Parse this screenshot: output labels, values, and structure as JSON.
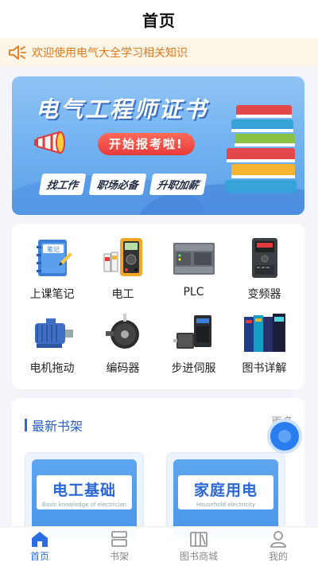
{
  "header": {
    "title": "首页"
  },
  "notice": {
    "text": "欢迎使用电气大全学习相关知识"
  },
  "banner": {
    "title": "电气工程师证书",
    "cta": "开始报考啦!",
    "tags": [
      "找工作",
      "职场必备",
      "升职加薪"
    ]
  },
  "grid": {
    "items": [
      {
        "label": "上课笔记",
        "icon": "notebook-icon"
      },
      {
        "label": "电工",
        "icon": "multimeter-icon"
      },
      {
        "label": "PLC",
        "icon": "plc-icon"
      },
      {
        "label": "变频器",
        "icon": "inverter-icon"
      },
      {
        "label": "电机拖动",
        "icon": "motor-icon"
      },
      {
        "label": "编码器",
        "icon": "encoder-icon"
      },
      {
        "label": "步进伺服",
        "icon": "servo-icon"
      },
      {
        "label": "图书详解",
        "icon": "books-icon"
      }
    ]
  },
  "shelf": {
    "title": "最新书架",
    "more": "更多",
    "books": [
      {
        "title": "电工基础",
        "subtitle": "Basic knowledge of electrician"
      },
      {
        "title": "家庭用电",
        "subtitle": "Household electricity"
      }
    ]
  },
  "tabbar": {
    "items": [
      {
        "label": "首页",
        "active": true
      },
      {
        "label": "书架",
        "active": false
      },
      {
        "label": "图书商城",
        "active": false
      },
      {
        "label": "我的",
        "active": false
      }
    ]
  },
  "colors": {
    "accent": "#2a6de0",
    "notice": "#e07a1f",
    "notice_bg": "#fdf5e6"
  }
}
